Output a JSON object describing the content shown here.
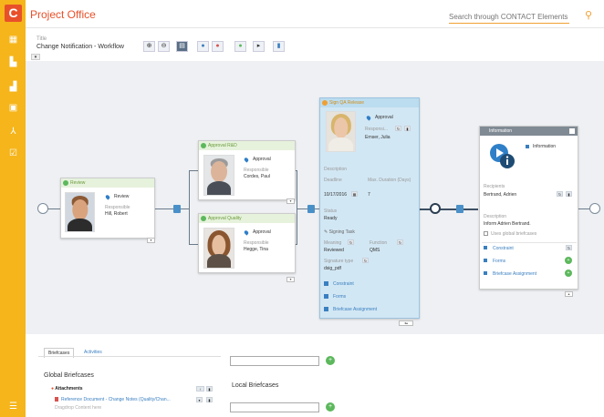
{
  "app": {
    "title": "Project Office",
    "search_placeholder": "Search through CONTACT Elements ...",
    "logo_letter": "C"
  },
  "doc": {
    "title_label": "Title",
    "title_value": "Change Notification - Workflow"
  },
  "toolbar": {
    "buttons": [
      "zoom-in-icon",
      "zoom-out-icon",
      "view-icon",
      "info-icon",
      "stop-icon",
      "play-icon",
      "step-icon",
      "lock-icon"
    ]
  },
  "review": {
    "header": "Review",
    "role": "Review",
    "resp_label": "Responsible",
    "person": "Hill, Robert"
  },
  "rnd": {
    "header": "Approval R&D",
    "role": "Approval",
    "resp_label": "Responsible",
    "person": "Cordes, Paul"
  },
  "quality": {
    "header": "Approval Quality",
    "role": "Approval",
    "resp_label": "Responsible",
    "person": "Hegge, Tina"
  },
  "sign": {
    "header": "Sign QA Release",
    "role": "Approval",
    "resp_label": "Responsi...",
    "person": "Ernser, Julia",
    "desc_label": "Description",
    "deadline_label": "Deadline",
    "deadline_value": "10/17/2016",
    "maxdur_label": "Max. Duration (Days)",
    "maxdur_value": "7",
    "status_label": "Status",
    "status_value": "Ready",
    "signing_label": "Signing Task",
    "meaning_label": "Meaning",
    "meaning_value": "Reviewed",
    "function_label": "Function",
    "function_value": "QMS",
    "sigtype_label": "Signature type",
    "sigtype_value": "dsig_pdf",
    "links": [
      "Constraint",
      "Forms",
      "Briefcase Assignment"
    ]
  },
  "info": {
    "header": "Information",
    "role": "Information",
    "recipients_label": "Recipients",
    "recipients_value": "Bertrand, Adrien",
    "desc_label": "Description",
    "desc_value": "Inform Adrien Bertrand.",
    "checkbox_label": "Uses global briefcases",
    "links": [
      "Constraint",
      "Forms",
      "Briefcase Assignment"
    ]
  },
  "bottom": {
    "tabs": [
      "Briefcases",
      "Activities"
    ],
    "global_title": "Global Briefcases",
    "attachments_label": "Attachments",
    "doc_link": "Reference Document - Change Notes (Quality/Chan...",
    "doc_sub": "Dragdrop Content here",
    "local_title": "Local Briefcases"
  },
  "colors": {
    "accent": "#f5b51b",
    "brand": "#e8502a",
    "highlight": "#bcdcef",
    "ok": "#5cb85c",
    "link": "#3a7fc0"
  }
}
